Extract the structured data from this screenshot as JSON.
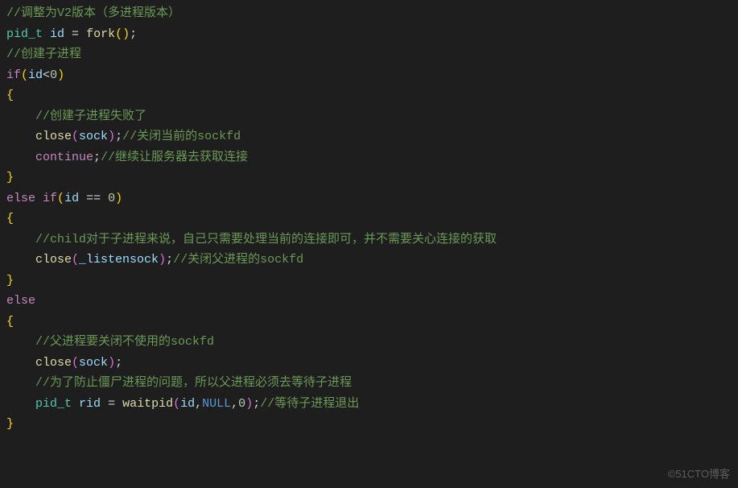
{
  "code": {
    "c1": "//调整为V2版本（多进程版本）",
    "l2_type": "pid_t",
    "l2_var": "id",
    "l2_eq": " = ",
    "l2_fn": "fork",
    "l2_open": "(",
    "l2_close": ")",
    "l2_semi": ";",
    "c3": "//创建子进程",
    "l4_if": "if",
    "l4_open": "(",
    "l4_var": "id",
    "l4_lt": "<",
    "l4_num": "0",
    "l4_close": ")",
    "l5_brace": "{",
    "c6": "//创建子进程失败了",
    "l7_fn": "close",
    "l7_open": "(",
    "l7_arg": "sock",
    "l7_close": ")",
    "l7_semi": ";",
    "c7": "//关闭当前的sockfd",
    "l8_kw": "continue",
    "l8_semi": ";",
    "c8": "//继续让服务器去获取连接",
    "l9_brace": "}",
    "l10_else": "else",
    "l10_if": "if",
    "l10_open": "(",
    "l10_var": "id",
    "l10_eq": " == ",
    "l10_num": "0",
    "l10_close": ")",
    "l11_brace": "{",
    "c12": "//child对于子进程来说，自己只需要处理当前的连接即可，并不需要关心连接的获取",
    "l13_fn": "close",
    "l13_open": "(",
    "l13_arg": "_listensock",
    "l13_close": ")",
    "l13_semi": ";",
    "c13": "//关闭父进程的sockfd",
    "l14_brace": "}",
    "l15_else": "else",
    "l16_brace": "{",
    "c17": "//父进程要关闭不使用的sockfd",
    "l18_fn": "close",
    "l18_open": "(",
    "l18_arg": "sock",
    "l18_close": ")",
    "l18_semi": ";",
    "c19": "//为了防止僵尸进程的问题，所以父进程必须去等待子进程",
    "l20_type": "pid_t",
    "l20_var": "rid",
    "l20_eq": " = ",
    "l20_fn": "waitpid",
    "l20_open": "(",
    "l20_a1": "id",
    "l20_c1": ",",
    "l20_a2": "NULL",
    "l20_c2": ",",
    "l20_a3": "0",
    "l20_close": ")",
    "l20_semi": ";",
    "c20": "//等待子进程退出",
    "l21_brace": "}"
  },
  "watermark": "©51CTO博客"
}
